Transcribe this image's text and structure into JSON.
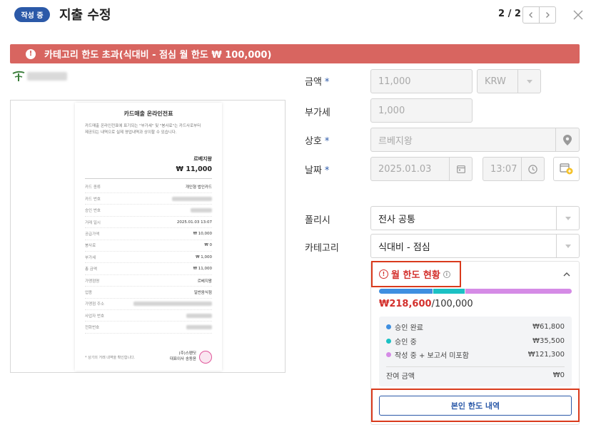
{
  "header": {
    "status": "작성 중",
    "title": "지출 수정",
    "pager": "2 / 2"
  },
  "alert": {
    "message": "카테고리 한도 초과(식대비 - 점심 월 한도 ₩ 100,000)"
  },
  "receipt": {
    "title": "카드매출 온라인전표",
    "note_line1": "카드매출 온라인전표에 표기되는 \"부가세\" 및 \"봉사료\"는 카드사로부터",
    "note_line2": "제공되는 내역으로 실제 영업내역과 상이할 수 있습니다.",
    "merchant": "르베지왕",
    "amount": "₩ 11,000",
    "rows": [
      {
        "label": "카드 종류",
        "value": "개인형 법인카드"
      },
      {
        "label": "카드 번호",
        "value": ""
      },
      {
        "label": "승인 번호",
        "value": ""
      },
      {
        "label": "거래 일시",
        "value": "2025.01.03 13:07"
      },
      {
        "label": "공급가액",
        "value": "₩ 10,000"
      },
      {
        "label": "봉사료",
        "value": "₩ 0"
      },
      {
        "label": "부가세",
        "value": "₩ 1,000"
      },
      {
        "label": "총 금액",
        "value": "₩ 11,000"
      },
      {
        "label": "가맹점명",
        "value": "르베지왕"
      },
      {
        "label": "업종",
        "value": "일반음식점"
      },
      {
        "label": "가맹점 주소",
        "value": ""
      },
      {
        "label": "사업자 번호",
        "value": ""
      },
      {
        "label": "전화번호",
        "value": ""
      }
    ],
    "footer_note": "* 상기의 거래 내역을 확인합니다.",
    "seal_line1": "(주)스펜딧",
    "seal_line2": "대표이사 송동윤"
  },
  "form": {
    "amount_label": "금액",
    "amount_value": "11,000",
    "currency": "KRW",
    "vat_label": "부가세",
    "vat_value": "1,000",
    "merchant_label": "상호",
    "merchant_value": "르베지왕",
    "date_label": "날짜",
    "date_value": "2025.01.03",
    "time_value": "13:07",
    "policy_label": "폴리시",
    "policy_value": "전사 공통",
    "category_label": "카테고리",
    "category_value": "식대비 - 점심",
    "required_mark": "*"
  },
  "limit": {
    "title": "월 한도 현황",
    "used": "₩218,600",
    "total": "/100,000",
    "bar": [
      {
        "fraction": 0.28,
        "color": "#3f8fe0"
      },
      {
        "fraction": 0.16,
        "color": "#1bc1c4"
      },
      {
        "fraction": 0.555,
        "color": "#d58be6"
      }
    ],
    "rows": [
      {
        "label": "승인 완료",
        "value": "₩61,800",
        "color": "#3f8fe0"
      },
      {
        "label": "승인 중",
        "value": "₩35,500",
        "color": "#1bc1c4"
      },
      {
        "label": "작성 중 + 보고서 미포함",
        "value": "₩121,300",
        "color": "#d58be6"
      }
    ],
    "remaining_label": "잔여 금액",
    "remaining_value": "₩0",
    "own_limit_button": "본인 한도 내역"
  },
  "colors": {
    "brand": "#2b59a8",
    "alert": "#d86560",
    "over": "#d3302c"
  }
}
